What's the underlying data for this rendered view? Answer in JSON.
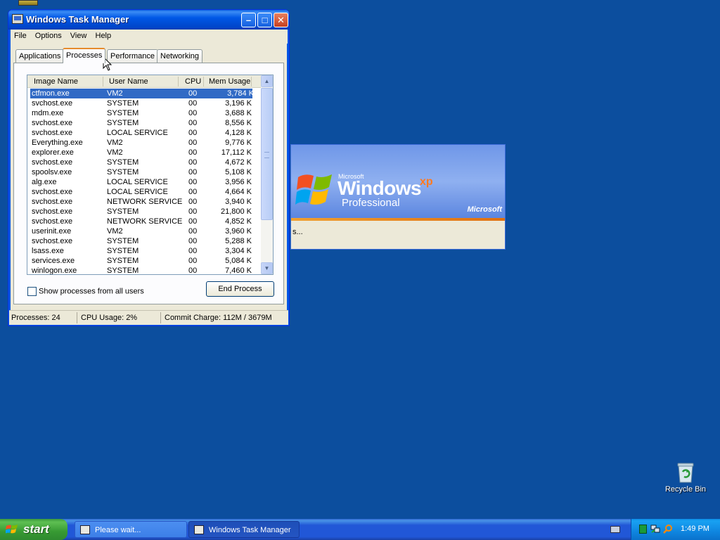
{
  "desktop": {
    "recycle_bin_label": "Recycle Bin"
  },
  "splash": {
    "microsoft_small": "Microsoft",
    "windows": "Windows",
    "xp": "xp",
    "edition": "Professional",
    "brand": "Microsoft",
    "status": "s..."
  },
  "task_manager": {
    "title": "Windows Task Manager",
    "menu": [
      "File",
      "Options",
      "View",
      "Help"
    ],
    "tabs": [
      "Applications",
      "Processes",
      "Performance",
      "Networking"
    ],
    "active_tab": "Processes",
    "columns": [
      "Image Name",
      "User Name",
      "CPU",
      "Mem Usage"
    ],
    "processes": [
      {
        "image": "ctfmon.exe",
        "user": "VM2",
        "cpu": "00",
        "mem": "3,784 K"
      },
      {
        "image": "svchost.exe",
        "user": "SYSTEM",
        "cpu": "00",
        "mem": "3,196 K"
      },
      {
        "image": "mdm.exe",
        "user": "SYSTEM",
        "cpu": "00",
        "mem": "3,688 K"
      },
      {
        "image": "svchost.exe",
        "user": "SYSTEM",
        "cpu": "00",
        "mem": "8,556 K"
      },
      {
        "image": "svchost.exe",
        "user": "LOCAL SERVICE",
        "cpu": "00",
        "mem": "4,128 K"
      },
      {
        "image": "Everything.exe",
        "user": "VM2",
        "cpu": "00",
        "mem": "9,776 K"
      },
      {
        "image": "explorer.exe",
        "user": "VM2",
        "cpu": "00",
        "mem": "17,112 K"
      },
      {
        "image": "svchost.exe",
        "user": "SYSTEM",
        "cpu": "00",
        "mem": "4,672 K"
      },
      {
        "image": "spoolsv.exe",
        "user": "SYSTEM",
        "cpu": "00",
        "mem": "5,108 K"
      },
      {
        "image": "alg.exe",
        "user": "LOCAL SERVICE",
        "cpu": "00",
        "mem": "3,956 K"
      },
      {
        "image": "svchost.exe",
        "user": "LOCAL SERVICE",
        "cpu": "00",
        "mem": "4,664 K"
      },
      {
        "image": "svchost.exe",
        "user": "NETWORK SERVICE",
        "cpu": "00",
        "mem": "3,940 K"
      },
      {
        "image": "svchost.exe",
        "user": "SYSTEM",
        "cpu": "00",
        "mem": "21,800 K"
      },
      {
        "image": "svchost.exe",
        "user": "NETWORK SERVICE",
        "cpu": "00",
        "mem": "4,852 K"
      },
      {
        "image": "userinit.exe",
        "user": "VM2",
        "cpu": "00",
        "mem": "3,960 K"
      },
      {
        "image": "svchost.exe",
        "user": "SYSTEM",
        "cpu": "00",
        "mem": "5,288 K"
      },
      {
        "image": "lsass.exe",
        "user": "SYSTEM",
        "cpu": "00",
        "mem": "3,304 K"
      },
      {
        "image": "services.exe",
        "user": "SYSTEM",
        "cpu": "00",
        "mem": "5,084 K"
      },
      {
        "image": "winlogon.exe",
        "user": "SYSTEM",
        "cpu": "00",
        "mem": "7,460 K"
      }
    ],
    "selected_row": 0,
    "show_all_label": "Show processes from all users",
    "show_all_checked": false,
    "end_process_label": "End Process",
    "status": {
      "processes": "Processes: 24",
      "cpu": "CPU Usage: 2%",
      "commit": "Commit Charge: 112M / 3679M"
    }
  },
  "taskbar": {
    "start_label": "start",
    "items": [
      "Please wait...",
      "Windows Task Manager"
    ],
    "clock": "1:49 PM"
  },
  "colors": {
    "desktop": "#0c4e9e",
    "selection": "#316ac5",
    "titlebar": "#0058e6",
    "start_button": "#379a33"
  }
}
